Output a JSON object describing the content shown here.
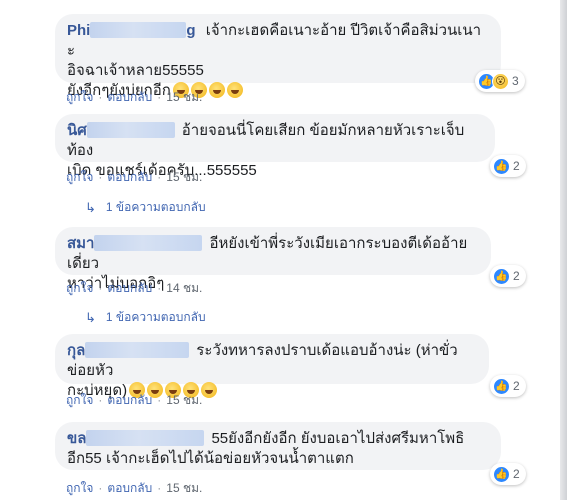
{
  "colors": {
    "author": "#385898",
    "bubble": "#f2f3f5",
    "link": "#4267b2",
    "meta": "#606770",
    "like": "#2d88ff"
  },
  "comments": [
    {
      "author": "Phi",
      "author_tail": "g",
      "line1": "เจ้ากะเฮดคือเนาะอ้าย ปีวิตเจ้าคือสิม่วนเนาะ",
      "line2": "อิจฉาเจ้าหลาย55555",
      "line3": "ยังอีกๆยังบ่ยกอีก",
      "emoji_icons": [
        "grin-sweat-emoji",
        "grin-emoji",
        "smile-emoji",
        "smile-emoji"
      ],
      "like_label": "ถูกใจ",
      "reply_label": "ตอบกลับ",
      "time": "15 ชม.",
      "reactions": {
        "icons": [
          "like-icon",
          "wow-icon"
        ],
        "count": "3"
      }
    },
    {
      "author": "นิศ",
      "line1": "อ้ายจอนนี่โคยเสียก ข้อยมักหลายหัวเราะเจ็บท้อง",
      "line2": "เบิด ขอแชร์เด้อครับ...555555",
      "like_label": "ถูกใจ",
      "reply_label": "ตอบกลับ",
      "time": "15 ชม.",
      "reactions": {
        "icons": [
          "like-icon"
        ],
        "count": "2"
      },
      "replies_label": "1 ข้อความตอบกลับ"
    },
    {
      "author": "สมา",
      "line1": "อีหยังเข้าพี่ระวังเมียเอากระบองตีเด้ออ้ายเดี่ยว",
      "line2": "หาว่าไม่บอกอิๆ",
      "like_label": "ถูกใจ",
      "reply_label": "ตอบกลับ",
      "time": "14 ชม.",
      "reactions": {
        "icons": [
          "like-icon"
        ],
        "count": "2"
      },
      "replies_label": "1 ข้อความตอบกลับ"
    },
    {
      "author": "กุล",
      "line1": "ระวังทหารลงปราบเด้อแอบอ้างน่ะ (ห่าขั่วข่อยหัว",
      "line2": "กะบ่หยุด)",
      "emoji_icons": [
        "rofl-emoji",
        "joy-emoji",
        "grin-emoji",
        "grin-emoji",
        "laugh-emoji"
      ],
      "like_label": "ถูกใจ",
      "reply_label": "ตอบกลับ",
      "time": "15 ชม.",
      "reactions": {
        "icons": [
          "like-icon"
        ],
        "count": "2"
      }
    },
    {
      "author": "ขล",
      "line1": "55ยังอีกยังอีก ยังบอเอาไปส่งศรีมหาโพธิ",
      "line2": "อีก55 เจ้ากะเฮ็ดไปได้น้อข่อยหัวจนน้ำตาแตก",
      "like_label": "ถูกใจ",
      "reply_label": "ตอบกลับ",
      "time": "15 ชม.",
      "reactions": {
        "icons": [
          "like-icon"
        ],
        "count": "2"
      }
    }
  ]
}
